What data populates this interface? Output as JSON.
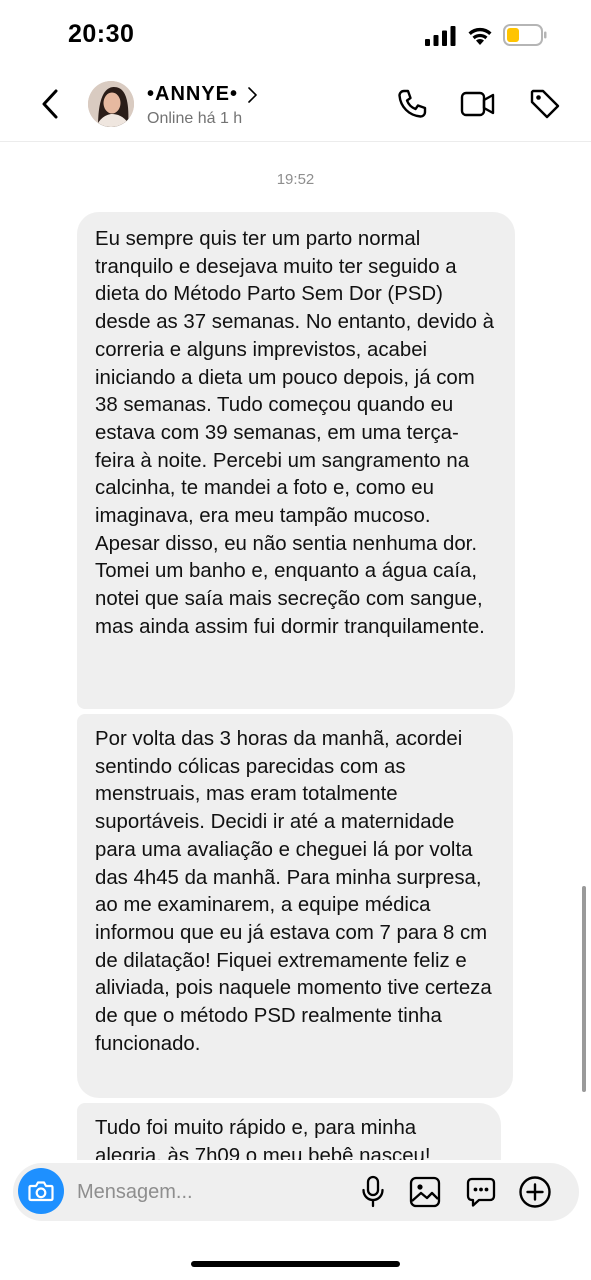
{
  "status_bar": {
    "time": "20:30",
    "icons": [
      "signal-icon",
      "wifi-icon",
      "battery-icon"
    ],
    "battery_color": "#ffc400"
  },
  "header": {
    "back_icon": "chevron-left-icon",
    "contact_name": "•ANNYE•",
    "contact_status": "Online há 1 h",
    "actions": [
      "phone-icon",
      "video-camera-icon",
      "tag-icon"
    ]
  },
  "chat": {
    "timestamp": "19:52",
    "messages": [
      {
        "text": "Eu sempre quis ter um parto normal tranquilo e desejava muito ter seguido a dieta do Método Parto Sem Dor (PSD) desde as 37 semanas. No entanto, devido à correria e alguns imprevistos, acabei iniciando a dieta um pouco depois, já com 38 semanas. Tudo começou quando eu estava com 39 semanas, em uma terça-feira à noite. Percebi um sangramento na calcinha, te mandei a foto e, como eu imaginava, era meu tampão mucoso. Apesar disso, eu não sentia nenhuma dor. Tomei um banho e, enquanto a água caía, notei que saía mais secreção com sangue, mas ainda assim fui dormir tranquilamente."
      },
      {
        "text": "Por volta das 3 horas da manhã, acordei sentindo cólicas parecidas com as menstruais, mas eram totalmente suportáveis. Decidi ir até a maternidade para uma avaliação e cheguei lá por volta das 4h45 da manhã. Para minha surpresa, ao me examinarem, a equipe médica informou que eu já estava com 7 para 8 cm de dilatação! Fiquei extremamente feliz e aliviada, pois naquele momento tive certeza de que o método PSD realmente tinha funcionado."
      },
      {
        "text": "Tudo foi muito rápido e, para minha alegria, às 7h09 o meu bebê nasceu!"
      }
    ],
    "bubble_color": "#efefef"
  },
  "composer": {
    "placeholder": "Mensagem...",
    "camera_icon": "camera-icon",
    "actions": [
      "microphone-icon",
      "image-gallery-icon",
      "sticker-icon",
      "plus-circle-icon"
    ],
    "accent_color": "#1e90ff"
  }
}
